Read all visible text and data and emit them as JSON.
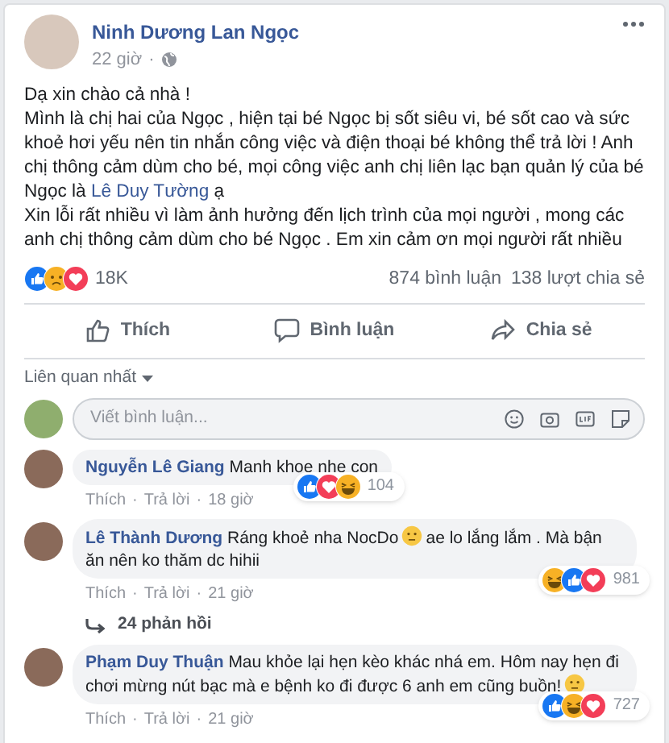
{
  "post": {
    "author": "Ninh Dương Lan Ngọc",
    "time": "22 giờ",
    "separator": "·",
    "body": [
      [
        {
          "kind": "text",
          "text": "Dạ xin chào cả nhà !"
        }
      ],
      [
        {
          "kind": "text",
          "text": "Mình là chị hai của Ngọc , hiện tại bé Ngọc bị sốt siêu vi, bé sốt cao và sức khoẻ hơi yếu nên tin nhắn công việc và điện thoại bé không thể trả lời ! Anh chị thông cảm dùm cho bé, mọi công việc anh chị liên lạc bạn quản lý của bé Ngọc là "
        },
        {
          "kind": "link",
          "text": "Lê Duy Tường"
        },
        {
          "kind": "text",
          "text": " ạ"
        }
      ],
      [
        {
          "kind": "text",
          "text": "Xin lỗi rất nhiều vì làm ảnh hưởng đến lịch trình của mọi người , mong các anh chị thông cảm dùm cho bé Ngọc . Em xin cảm ơn mọi người rất nhiều"
        }
      ]
    ],
    "reactions": [
      {
        "kind": "like"
      },
      {
        "kind": "sad"
      },
      {
        "kind": "love"
      }
    ],
    "reaction_count": "18K",
    "comment_count": "874 bình luận",
    "share_count": "138 lượt chia sẻ",
    "actions": [
      {
        "kind": "like",
        "label": "Thích"
      },
      {
        "kind": "comment",
        "label": "Bình luận"
      },
      {
        "kind": "share",
        "label": "Chia sẻ"
      }
    ]
  },
  "sort": "Liên quan nhất",
  "composer": {
    "placeholder": "Viết bình luận..."
  },
  "comments": [
    {
      "author": "Nguyễn Lê Giang",
      "segments": [
        {
          "kind": "text",
          "text": "Manh khoe nhe con"
        }
      ],
      "like": "Thích",
      "reply": "Trả lời",
      "time": "18 giờ",
      "reactions": [
        {
          "kind": "like"
        },
        {
          "kind": "love"
        },
        {
          "kind": "haha"
        }
      ],
      "count": "104",
      "separator": "·"
    },
    {
      "author": "Lê Thành Dương",
      "segments": [
        {
          "kind": "text",
          "text": "Ráng khoẻ nha NocDo"
        },
        {
          "kind": "emoji"
        },
        {
          "kind": "text",
          "text": "ae lo lắng lắm . Mà bận ăn nên ko thăm dc hihii"
        }
      ],
      "like": "Thích",
      "reply": "Trả lời",
      "time": "21 giờ",
      "reactions": [
        {
          "kind": "haha"
        },
        {
          "kind": "like"
        },
        {
          "kind": "love"
        }
      ],
      "count": "981",
      "replies": "24 phản hồi",
      "separator": "·"
    },
    {
      "author": "Phạm Duy Thuận",
      "segments": [
        {
          "kind": "text",
          "text": "Mau khỏe lại hẹn kèo khác nhá em. Hôm nay hẹn đi chơi mừng nút bạc mà e bệnh ko đi được 6 anh em cũng buồn!"
        },
        {
          "kind": "emoji"
        }
      ],
      "like": "Thích",
      "reply": "Trả lời",
      "time": "21 giờ",
      "reactions": [
        {
          "kind": "like"
        },
        {
          "kind": "haha"
        },
        {
          "kind": "love"
        }
      ],
      "count": "727",
      "separator": "·"
    }
  ]
}
